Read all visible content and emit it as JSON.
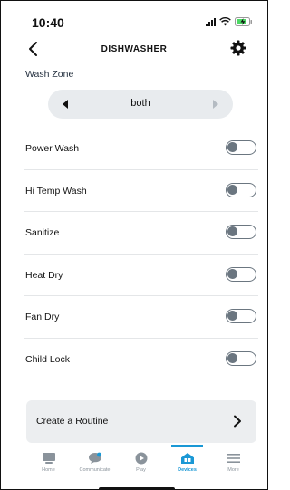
{
  "status": {
    "time": "10:40"
  },
  "header": {
    "title": "DISHWASHER"
  },
  "wash_zone": {
    "label": "Wash Zone",
    "value": "both"
  },
  "settings": [
    {
      "label": "Power Wash",
      "enabled": false
    },
    {
      "label": "Hi Temp Wash",
      "enabled": false
    },
    {
      "label": "Sanitize",
      "enabled": false
    },
    {
      "label": "Heat Dry",
      "enabled": false
    },
    {
      "label": "Fan Dry",
      "enabled": false
    },
    {
      "label": "Child Lock",
      "enabled": false
    }
  ],
  "routine": {
    "label": "Create a Routine"
  },
  "tabs": [
    {
      "label": "Home",
      "icon": "home-icon"
    },
    {
      "label": "Communicate",
      "icon": "chat-bubble-icon"
    },
    {
      "label": "Play",
      "icon": "play-icon"
    },
    {
      "label": "Devices",
      "icon": "devices-icon",
      "active": true
    },
    {
      "label": "More",
      "icon": "menu-icon"
    }
  ],
  "colors": {
    "accent": "#1a98d5",
    "text": "#232f3e",
    "toggle_off": "#6b7680",
    "pill_bg": "#e8ebee"
  }
}
